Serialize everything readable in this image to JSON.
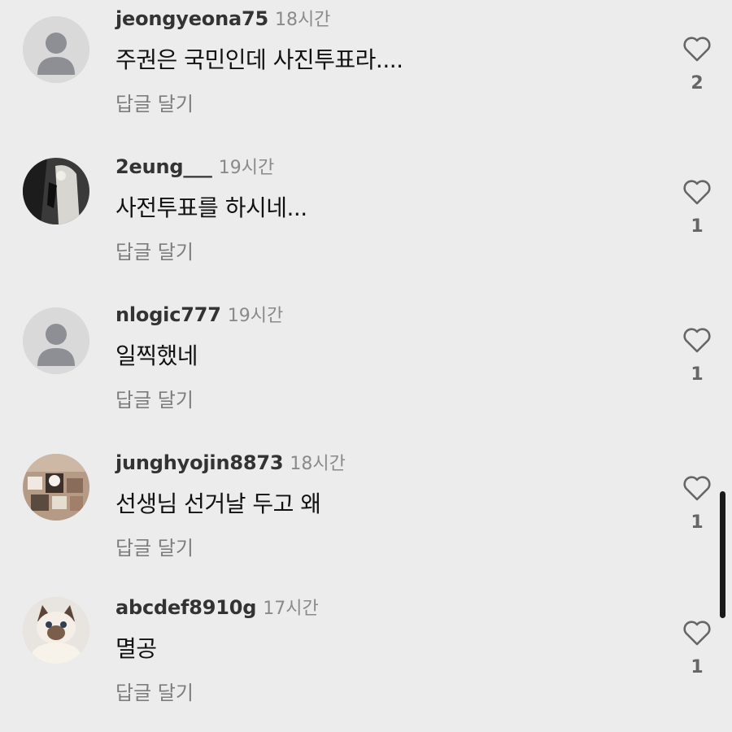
{
  "reply_label": "답글 달기",
  "comments": [
    {
      "username": "jeongyeona75",
      "time": "18시간",
      "text": "주권은 국민인데 사진투표라....",
      "likes": "2",
      "avatar": "default-avatar"
    },
    {
      "username": "2eung___",
      "time": "19시간",
      "text": "사전투표를 하시네...",
      "likes": "1",
      "avatar": "photo-avatar-dark"
    },
    {
      "username": "nlogic777",
      "time": "19시간",
      "text": "일찍했네",
      "likes": "1",
      "avatar": "default-avatar"
    },
    {
      "username": "junghyojin8873",
      "time": "18시간",
      "text": "선생님 선거날 두고 왜",
      "likes": "1",
      "avatar": "photo-avatar-collage"
    },
    {
      "username": "abcdef8910g",
      "time": "17시간",
      "text": "멸공",
      "likes": "1",
      "avatar": "photo-avatar-cat"
    }
  ],
  "colors": {
    "background": "#ececec",
    "username": "#333333",
    "muted": "#8a8a8a",
    "text": "#111111"
  }
}
